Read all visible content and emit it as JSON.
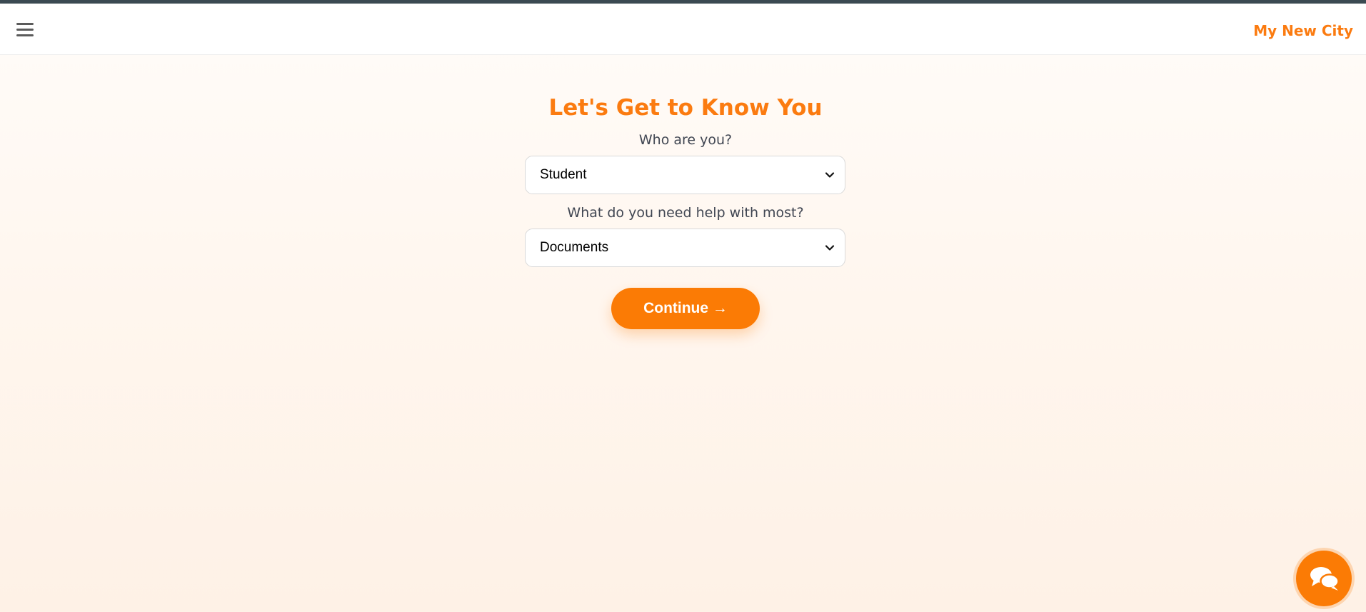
{
  "header": {
    "brand": "My New City",
    "menu_icon": "hamburger-menu-icon"
  },
  "form": {
    "title": "Let's Get to Know You",
    "who_label": "Who are you?",
    "who_value": "Student",
    "help_label": "What do you need help with most?",
    "help_value": "Documents",
    "continue_label": "Continue →"
  },
  "chat": {
    "icon": "chat-bubbles-icon"
  },
  "colors": {
    "accent": "#fb7b10",
    "top_strip": "#3b4a52",
    "label_text": "#404652"
  }
}
